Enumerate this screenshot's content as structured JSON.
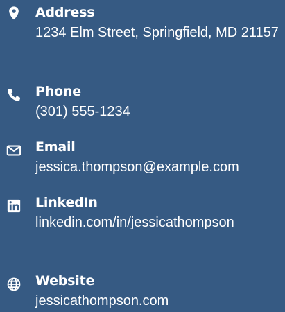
{
  "contact": {
    "items": [
      {
        "icon": "map-marker-icon",
        "label": "Address",
        "value": "1234 Elm Street, Springfield, MD 21157"
      },
      {
        "icon": "phone-icon",
        "label": "Phone",
        "value": "(301) 555-1234"
      },
      {
        "icon": "envelope-icon",
        "label": "Email",
        "value": "jessica.thompson@example.com"
      },
      {
        "icon": "linkedin-icon",
        "label": "LinkedIn",
        "value": "linkedin.com/in/jessicathompson"
      },
      {
        "icon": "globe-icon",
        "label": "Website",
        "value": "jessicathompson.com"
      }
    ]
  },
  "colors": {
    "background": "#365a83",
    "text": "#ffffff"
  }
}
